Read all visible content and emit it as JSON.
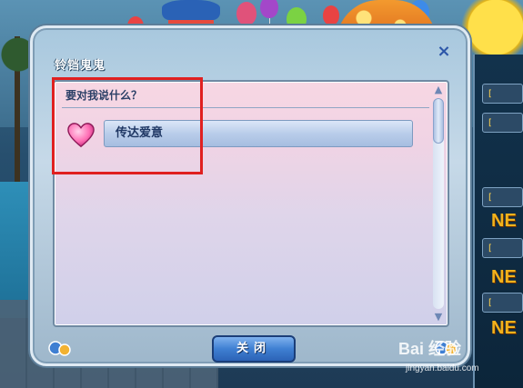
{
  "dialog": {
    "title": "铃铛鬼鬼",
    "close_glyph": "×",
    "prompt": "要对我说什么？",
    "options": [
      {
        "label": "传达爱意",
        "icon": "heart-icon"
      }
    ],
    "close_button_label": "关闭"
  },
  "background": {
    "side_tags": [
      "[",
      "[",
      "[",
      "[",
      "[",
      "[",
      "["
    ],
    "new_badges": [
      "NE",
      "NE",
      "NE",
      "NE"
    ]
  },
  "watermark": {
    "brand": "Bai 经验",
    "url": "jingyan.baidu.com"
  },
  "colors": {
    "highlight_box": "#e02020",
    "heart": "#ff6fb5",
    "close_button": "#3f7fd2"
  }
}
